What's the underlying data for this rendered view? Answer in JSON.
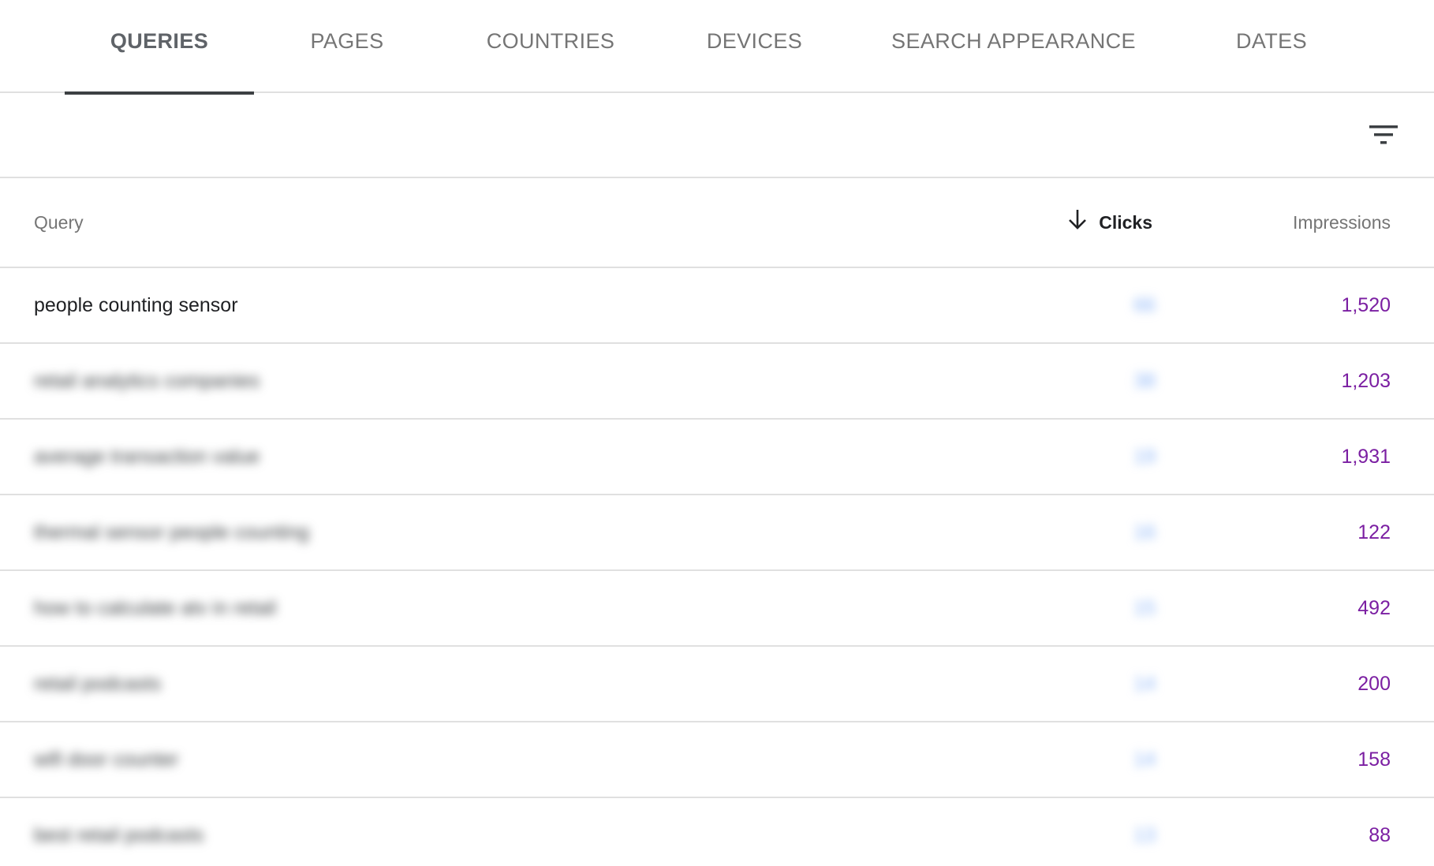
{
  "tabs": [
    {
      "label": "QUERIES",
      "active": true
    },
    {
      "label": "PAGES",
      "active": false
    },
    {
      "label": "COUNTRIES",
      "active": false
    },
    {
      "label": "DEVICES",
      "active": false
    },
    {
      "label": "SEARCH APPEARANCE",
      "active": false
    },
    {
      "label": "DATES",
      "active": false
    }
  ],
  "toolbar": {
    "filter_icon": "filter-list-icon"
  },
  "table": {
    "headers": {
      "query": "Query",
      "clicks": "Clicks",
      "impressions": "Impressions",
      "sort_icon": "arrow-down-icon"
    },
    "rows": [
      {
        "query": "people counting sensor",
        "clicks": "66",
        "impressions": "1,520",
        "blurred": false
      },
      {
        "query": "retail analytics companies",
        "clicks": "38",
        "impressions": "1,203",
        "blurred": true
      },
      {
        "query": "average transaction value",
        "clicks": "19",
        "impressions": "1,931",
        "blurred": true
      },
      {
        "query": "thermal sensor people counting",
        "clicks": "16",
        "impressions": "122",
        "blurred": true
      },
      {
        "query": "how to calculate atv in retail",
        "clicks": "15",
        "impressions": "492",
        "blurred": true
      },
      {
        "query": "retail podcasts",
        "clicks": "14",
        "impressions": "200",
        "blurred": true
      },
      {
        "query": "wifi door counter",
        "clicks": "14",
        "impressions": "158",
        "blurred": true
      },
      {
        "query": "best retail podcasts",
        "clicks": "13",
        "impressions": "88",
        "blurred": true
      }
    ]
  },
  "colors": {
    "impressions": "#7b1fa2",
    "clicks": "#8ab4f8",
    "active_tab_indicator": "#3c4043",
    "divider": "#e0e0e0"
  }
}
